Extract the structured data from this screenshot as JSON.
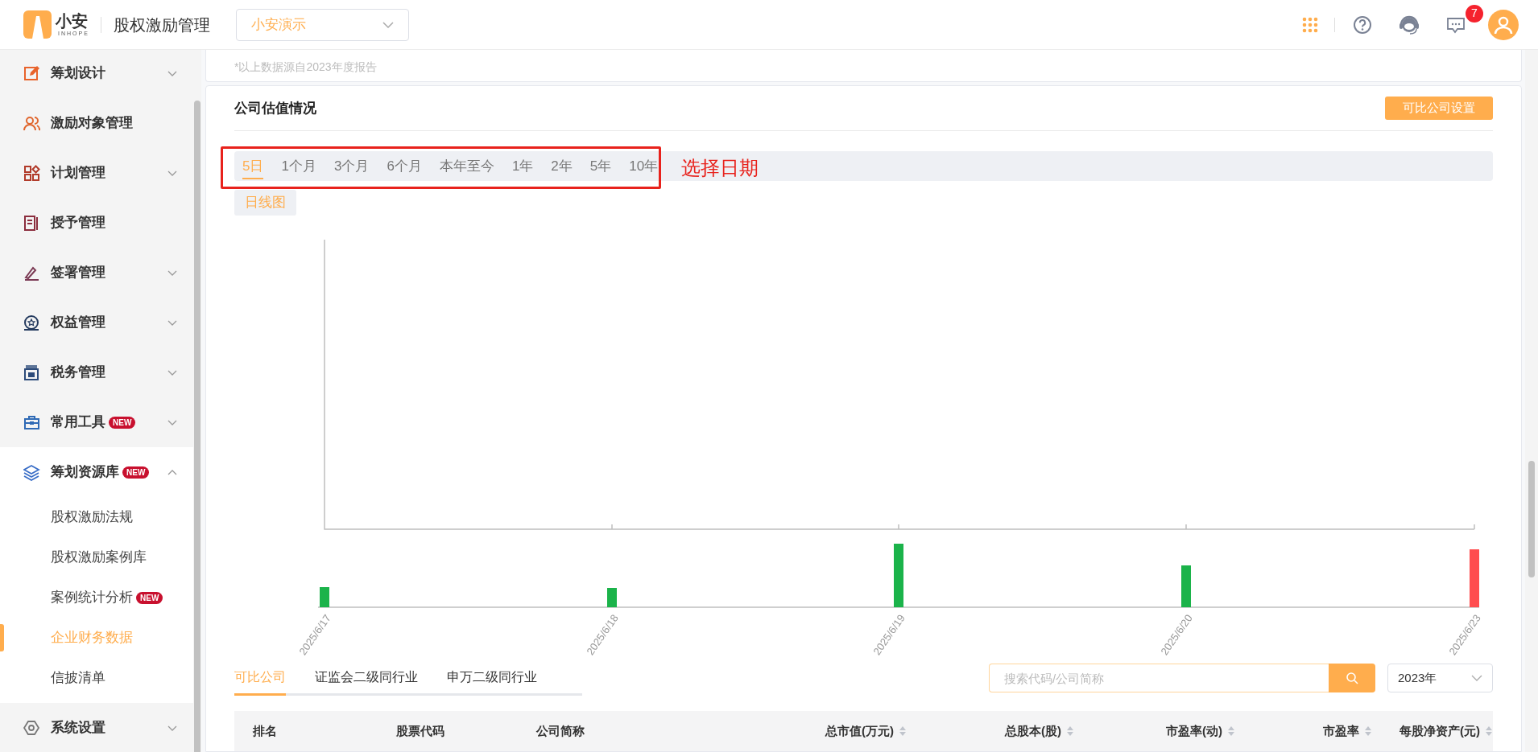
{
  "header": {
    "logo_text": "小安",
    "logo_subtext": "INHOPE",
    "app_title": "股权激励管理",
    "company_select": "小安演示",
    "notification_count": "7"
  },
  "sidebar": {
    "items": [
      {
        "label": "筹划设计",
        "expanded": false
      },
      {
        "label": "激励对象管理"
      },
      {
        "label": "计划管理",
        "expanded": false
      },
      {
        "label": "授予管理"
      },
      {
        "label": "签署管理",
        "expanded": false
      },
      {
        "label": "权益管理",
        "expanded": false
      },
      {
        "label": "税务管理",
        "expanded": false
      },
      {
        "label": "常用工具",
        "badge": "NEW",
        "expanded": false
      },
      {
        "label": "筹划资源库",
        "badge": "NEW",
        "expanded": true,
        "children": [
          {
            "label": "股权激励法规",
            "selected": false
          },
          {
            "label": "股权激励案例库",
            "selected": false
          },
          {
            "label": "案例统计分析",
            "badge": "NEW",
            "selected": false
          },
          {
            "label": "企业财务数据",
            "selected": true
          },
          {
            "label": "信披清单",
            "selected": false
          }
        ]
      },
      {
        "label": "系统设置",
        "expanded": false
      }
    ]
  },
  "source_note": "*以上数据源自2023年度报告",
  "valuation": {
    "title": "公司估值情况",
    "settings_button": "可比公司设置",
    "ranges": [
      {
        "label": "5日",
        "selected": true
      },
      {
        "label": "1个月",
        "selected": false
      },
      {
        "label": "3个月",
        "selected": false
      },
      {
        "label": "6个月",
        "selected": false
      },
      {
        "label": "本年至今",
        "selected": false
      },
      {
        "label": "1年",
        "selected": false
      },
      {
        "label": "2年",
        "selected": false
      },
      {
        "label": "5年",
        "selected": false
      },
      {
        "label": "10年",
        "selected": false
      }
    ],
    "annotation": "选择日期",
    "chart_type_button": "日线图",
    "chart_dates": [
      "2025/6/17",
      "2025/6/18",
      "2025/6/19",
      "2025/6/20",
      "2025/6/23"
    ]
  },
  "peer_tabs": [
    {
      "label": "可比公司",
      "selected": true
    },
    {
      "label": "证监会二级同行业",
      "selected": false
    },
    {
      "label": "申万二级同行业",
      "selected": false
    }
  ],
  "search": {
    "placeholder": "搜索代码/公司简称"
  },
  "year_select": "2023年",
  "table": {
    "columns": [
      {
        "label": "排名",
        "sortable": false
      },
      {
        "label": "股票代码",
        "sortable": false
      },
      {
        "label": "公司简称",
        "sortable": false
      },
      {
        "label": "总市值(万元)",
        "sortable": true
      },
      {
        "label": "总股本(股)",
        "sortable": true
      },
      {
        "label": "市盈率(动)",
        "sortable": true
      },
      {
        "label": "市盈率",
        "sortable": true
      },
      {
        "label": "每股净资产(元)",
        "sortable": true
      }
    ]
  }
}
